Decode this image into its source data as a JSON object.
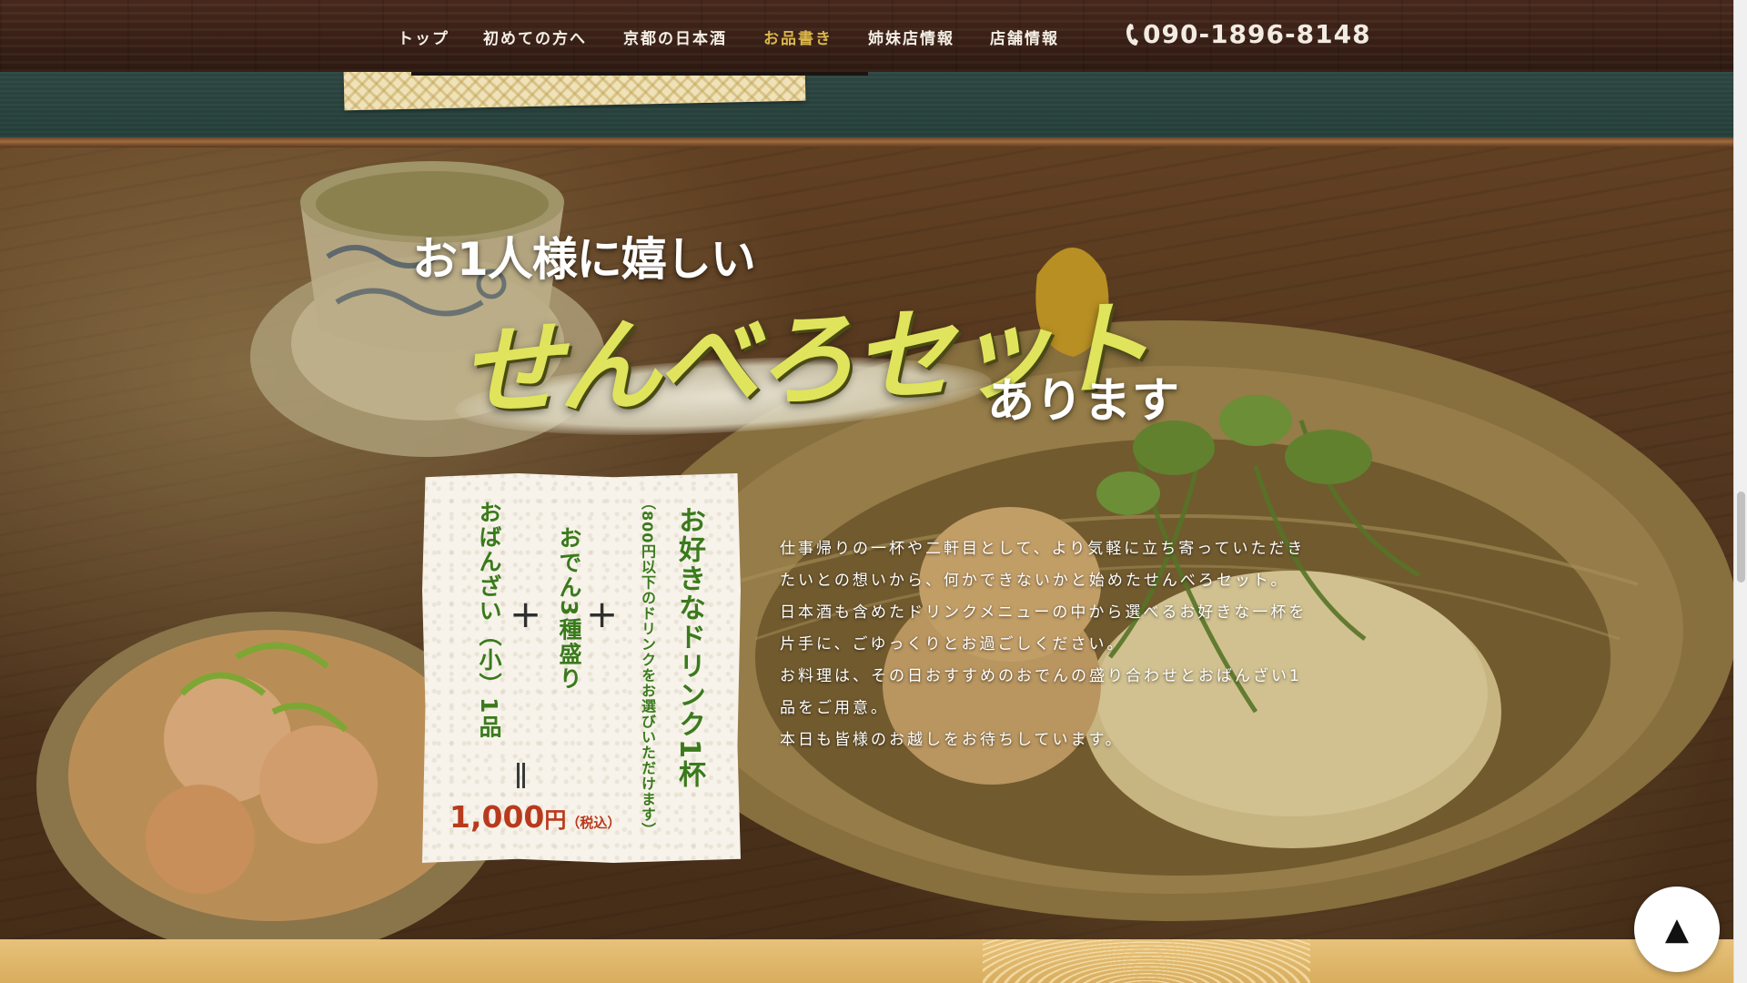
{
  "nav": {
    "items": [
      {
        "label": "トップ"
      },
      {
        "label": "初めての方へ"
      },
      {
        "label": "京都の日本酒"
      },
      {
        "label": "お品書き",
        "active": true
      },
      {
        "label": "姉妹店情報"
      },
      {
        "label": "店舗情報"
      }
    ],
    "phone": "090-1896-8148",
    "phone_icon": "phone-icon",
    "active_color": "#d9b64a"
  },
  "hero": {
    "heading_small": "お1人様に嬉しい",
    "heading_big": "せんべろセット",
    "heading_suffix": "あります",
    "heading_big_color": "#e0e45c"
  },
  "card": {
    "drink": "お好きなドリンク1杯",
    "drink_note": "（800円以下のドリンクをお選びいただけます）",
    "plus": "+",
    "oden": "おでん3種盛り",
    "obanzai": "おばんざい（小）1品",
    "price_amount": "1,000",
    "price_unit": "円",
    "price_tax": "（税込）",
    "text_color": "#3a7a1c",
    "price_color": "#b83a1d"
  },
  "description": {
    "lines": [
      "仕事帰りの一杯や二軒目として、より気軽に立ち寄っていただき",
      "たいとの想いから、何かできないかと始めたせんべろセット。",
      "日本酒も含めたドリンクメニューの中から選べるお好きな一杯を",
      "片手に、ごゆっくりとお過ごしください。",
      "お料理は、その日おすすめのおでんの盛り合わせとおばんざい1",
      "品をご用意。",
      "本日も皆様のお越しをお待ちしています。"
    ]
  },
  "back_to_top": {
    "label": "▲",
    "icon": "arrow-up-icon"
  }
}
